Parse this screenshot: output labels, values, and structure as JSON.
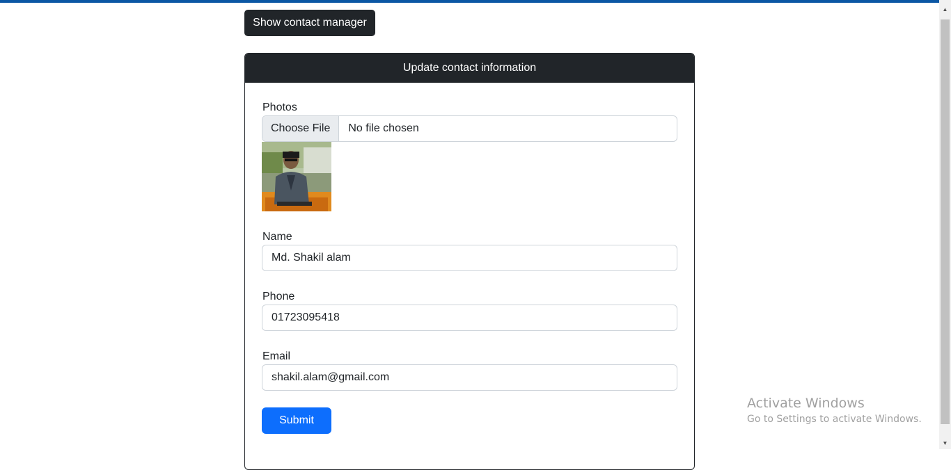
{
  "toolbar": {
    "show_contact_manager_label": "Show contact manager"
  },
  "form": {
    "header_title": "Update contact information",
    "photos": {
      "label": "Photos",
      "choose_file_label": "Choose File",
      "file_status": "No file chosen"
    },
    "name": {
      "label": "Name",
      "value": "Md. Shakil alam"
    },
    "phone": {
      "label": "Phone",
      "value": "01723095418"
    },
    "email": {
      "label": "Email",
      "value": "shakil.alam@gmail.com"
    },
    "submit_label": "Submit"
  },
  "watermark": {
    "title": "Activate Windows",
    "subtitle": "Go to Settings to activate Windows."
  },
  "colors": {
    "top_strip": "#0b57a4",
    "dark": "#212529",
    "primary": "#0d6efd"
  },
  "icons": {
    "scroll_up": "triangle-up",
    "scroll_down": "triangle-down"
  }
}
